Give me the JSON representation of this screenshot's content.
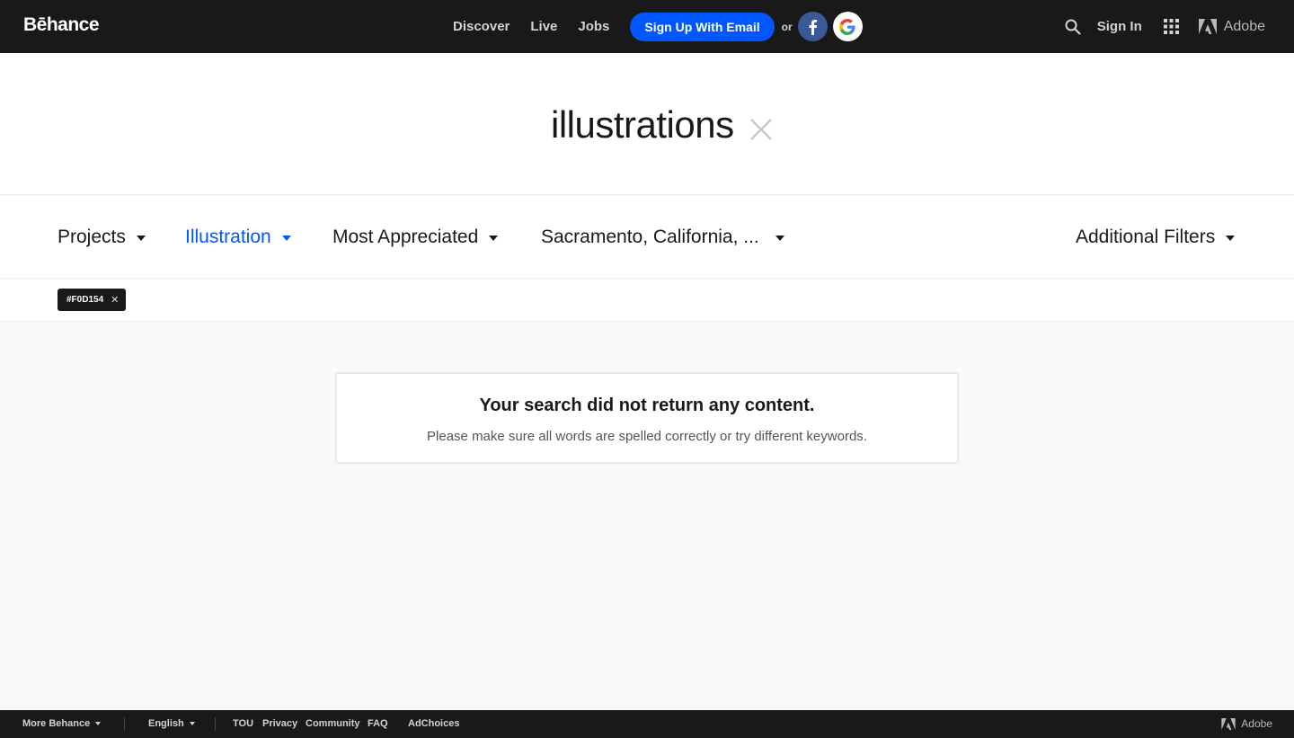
{
  "header": {
    "logo": "Bēhance",
    "nav": [
      "Discover",
      "Live",
      "Jobs"
    ],
    "signup_label": "Sign Up With Email",
    "or_label": "or",
    "signin_label": "Sign In",
    "adobe_label": "Adobe"
  },
  "search": {
    "query": "illustrations"
  },
  "filters": {
    "items": [
      {
        "label": "Projects"
      },
      {
        "label": "Illustration"
      },
      {
        "label": "Most Appreciated"
      },
      {
        "label": "Sacramento, California, ..."
      }
    ],
    "additional_label": "Additional Filters",
    "active_index": 1
  },
  "tags": [
    {
      "label": "#F0D154"
    }
  ],
  "empty_state": {
    "title": "Your search did not return any content.",
    "subtitle": "Please make sure all words are spelled correctly or try different keywords."
  },
  "footer": {
    "more_label": "More Behance",
    "language_label": "English",
    "links": [
      "TOU",
      "Privacy",
      "Community",
      "FAQ",
      "AdChoices"
    ],
    "adobe_label": "Adobe"
  },
  "colors": {
    "accent": "#0057ff",
    "dark": "#191919",
    "facebook": "#3b5998"
  }
}
